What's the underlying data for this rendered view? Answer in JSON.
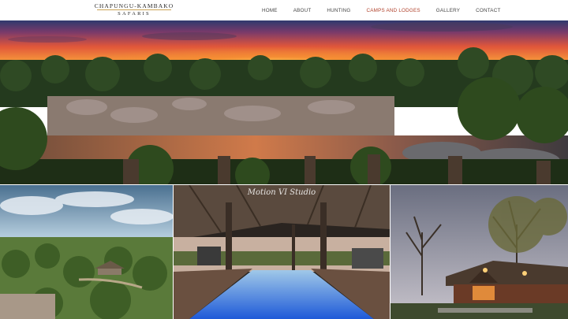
{
  "brand": {
    "line1": "CHAPUNGU-KAMBAKO",
    "line2": "SAFARIS",
    "accent": "#c9a356"
  },
  "nav": {
    "items": [
      {
        "label": "HOME",
        "active": false
      },
      {
        "label": "ABOUT",
        "active": false
      },
      {
        "label": "HUNTING",
        "active": false
      },
      {
        "label": "CAMPS AND LODGES",
        "active": true
      },
      {
        "label": "GALLERY",
        "active": false
      },
      {
        "label": "CONTACT",
        "active": false
      }
    ],
    "active_color": "#b0402a"
  },
  "hero": {
    "image": "sunset-river-landscape"
  },
  "gallery": {
    "images": [
      {
        "image": "aerial-bush-camp"
      },
      {
        "image": "lodge-pool-thatch",
        "watermark": "Motion VI Studio"
      },
      {
        "image": "thatched-lodge-dusk"
      }
    ]
  }
}
